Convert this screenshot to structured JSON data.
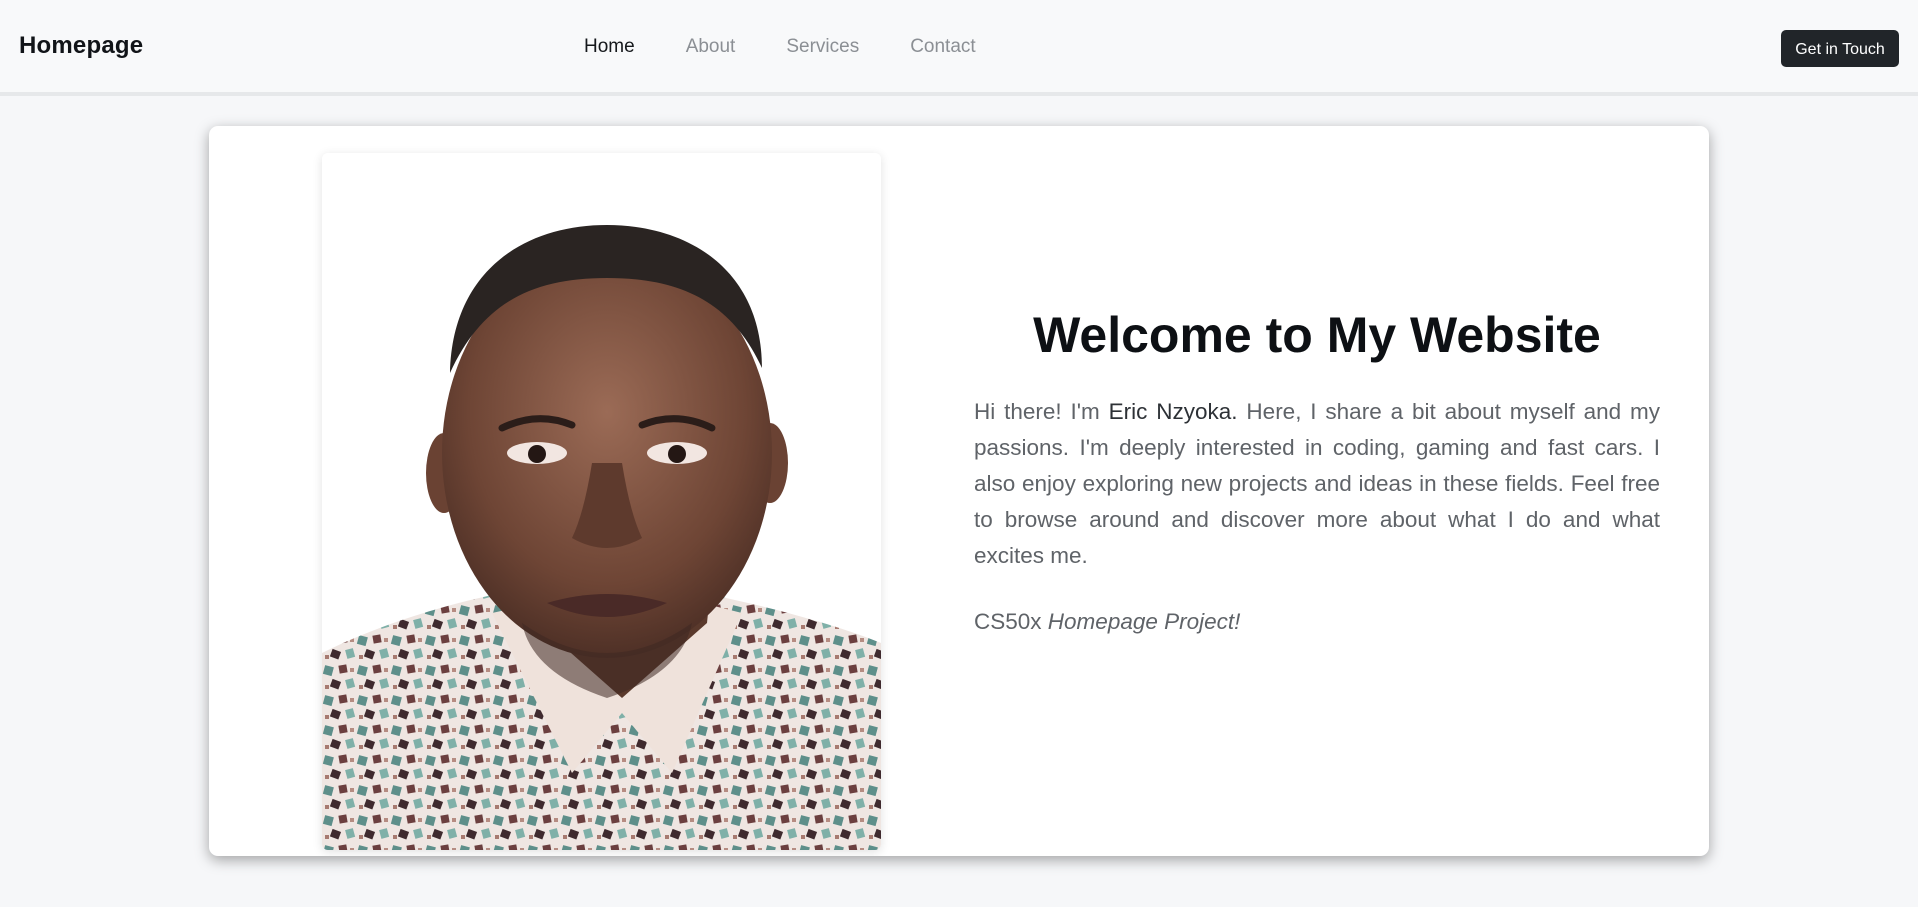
{
  "navbar": {
    "brand": "Homepage",
    "links": [
      {
        "label": "Home",
        "active": true
      },
      {
        "label": "About",
        "active": false
      },
      {
        "label": "Services",
        "active": false
      },
      {
        "label": "Contact",
        "active": false
      }
    ],
    "cta_label": "Get in Touch"
  },
  "hero": {
    "photo_icon": "profile-photo",
    "headline": "Welcome to My Website",
    "intro_before_name": "Hi there! I'm ",
    "name": "Eric Nzyoka.",
    "intro_after_name": " Here, I share a bit about myself and my passions. I'm deeply interested in coding, gaming and fast cars. I also enjoy exploring new projects and ideas in these fields. Feel free to browse around and discover more about what I do and what excites me.",
    "tagline_prefix": "CS50x ",
    "tagline_italic": "Homepage Project!"
  },
  "colors": {
    "page_bg": "#f6f7f9",
    "navbar_bg": "#f8f9fa",
    "cta_bg": "#212529",
    "text_muted": "#5f6368",
    "heading": "#0d1014"
  }
}
